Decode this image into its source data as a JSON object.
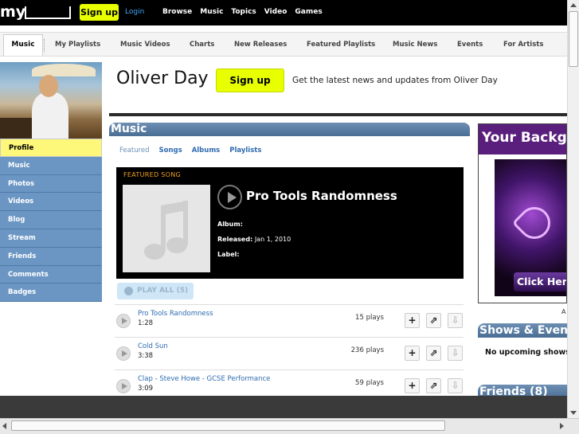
{
  "topbar": {
    "logo": "my",
    "signup_label": "Sign up",
    "login_label": "Login",
    "nav": [
      "Browse",
      "Music",
      "Topics",
      "Video",
      "Games"
    ]
  },
  "subnav": {
    "items": [
      "Music",
      "My Playlists",
      "Music Videos",
      "Charts",
      "New Releases",
      "Featured Playlists",
      "Music News",
      "Events",
      "For Artists"
    ]
  },
  "sidebar": {
    "items": [
      "Profile",
      "Music",
      "Photos",
      "Videos",
      "Blog",
      "Stream",
      "Friends",
      "Comments",
      "Badges"
    ]
  },
  "artist": {
    "name": "Oliver Day",
    "signup_label": "Sign up",
    "tagline": "Get the latest news and updates from Oliver Day"
  },
  "music": {
    "header": "Music",
    "tabs": [
      "Featured",
      "Songs",
      "Albums",
      "Playlists"
    ],
    "featured": {
      "label": "FEATURED SONG",
      "title": "Pro Tools Randomness",
      "album_label": "Album:",
      "album_value": "",
      "released_label": "Released:",
      "released_value": "Jan 1, 2010",
      "label_label": "Label:",
      "label_value": ""
    },
    "play_all": "PLAY ALL (5)",
    "songs": [
      {
        "name": "Pro Tools Randomness",
        "duration": "1:28",
        "plays": "15 plays"
      },
      {
        "name": "Cold Sun",
        "duration": "3:38",
        "plays": "236 plays"
      },
      {
        "name": "Clap - Steve Howe - GCSE Performance",
        "duration": "3:09",
        "plays": "59 plays"
      }
    ],
    "action_icons": [
      "+",
      "⇗",
      "⇩"
    ]
  },
  "right": {
    "ad_headline": "Your Backg",
    "ad_button": "Click Here",
    "ad_caption": "A",
    "shows_header": "Shows & Even",
    "no_shows": "No upcoming shows",
    "friends_header": "Friends (8)"
  }
}
